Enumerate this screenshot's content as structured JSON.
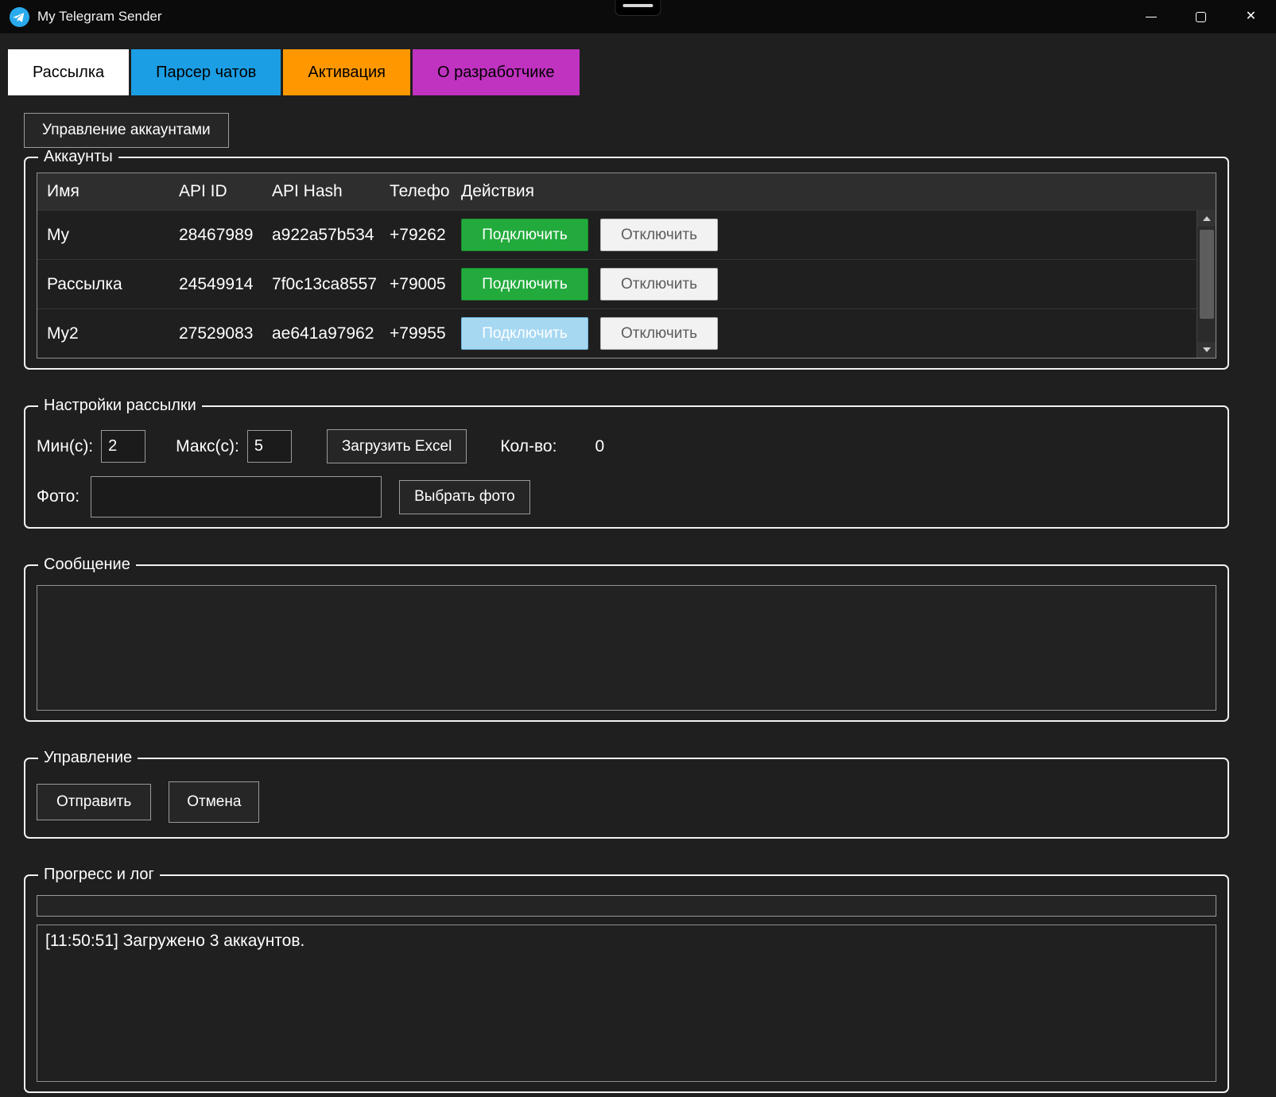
{
  "window": {
    "title": "My Telegram Sender"
  },
  "icons": {
    "close": "✕"
  },
  "colors": {
    "tab_active_bg": "#ffffff",
    "tab_parser_bg": "#1b9ee4",
    "tab_activation_bg": "#ff9800",
    "tab_about_bg": "#c032c0",
    "connect_green": "#22ab3c",
    "connect_pressed_blue": "#a6d8f2",
    "disconnect_bg": "#f2f2f2"
  },
  "tabs": {
    "mailing": "Рассылка",
    "parser": "Парсер чатов",
    "activation": "Активация",
    "about": "О разработчике"
  },
  "toolbar": {
    "manage_accounts": "Управление аккаунтами"
  },
  "accounts": {
    "legend": "Аккаунты",
    "columns": {
      "name": "Имя",
      "api_id": "API ID",
      "api_hash": "API Hash",
      "phone": "Телефо",
      "actions": "Действия"
    },
    "connect_label": "Подключить",
    "disconnect_label": "Отключить",
    "rows": [
      {
        "name": "My",
        "api_id": "28467989",
        "api_hash": "a922a57b534",
        "phone": "+79262"
      },
      {
        "name": "Рассылка",
        "api_id": "24549914",
        "api_hash": "7f0c13ca8557",
        "phone": "+79005"
      },
      {
        "name": "My2",
        "api_id": "27529083",
        "api_hash": "ae641a97962",
        "phone": "+79955"
      }
    ]
  },
  "settings": {
    "legend": "Настройки рассылки",
    "min_label": "Мин(с):",
    "min_value": "2",
    "max_label": "Макс(с):",
    "max_value": "5",
    "load_excel_button": "Загрузить Excel",
    "count_label": "Кол-во:",
    "count_value": "0",
    "photo_label": "Фото:",
    "photo_value": "",
    "choose_photo_button": "Выбрать фото"
  },
  "message": {
    "legend": "Сообщение",
    "value": ""
  },
  "control": {
    "legend": "Управление",
    "send_button": "Отправить",
    "cancel_button": "Отмена"
  },
  "progress": {
    "legend": "Прогресс и лог",
    "log_lines": [
      "[11:50:51] Загружено 3 аккаунтов."
    ]
  }
}
